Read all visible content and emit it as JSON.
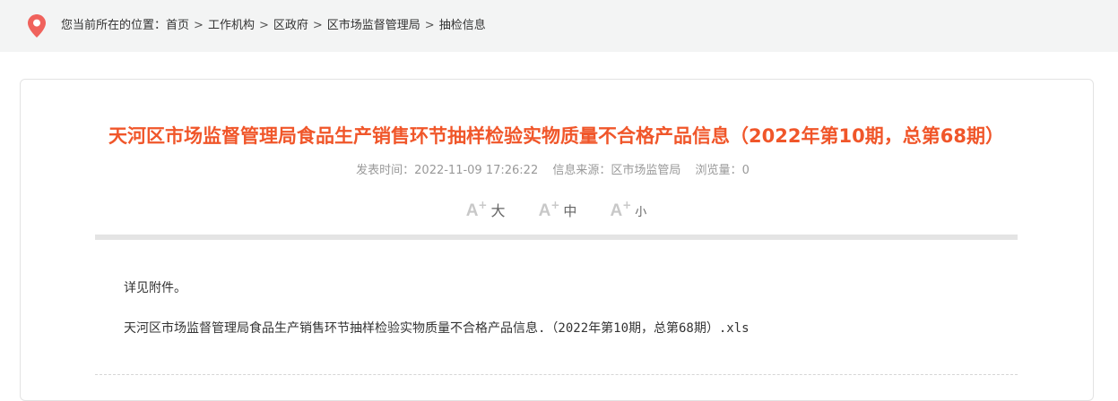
{
  "breadcrumb": {
    "prefix": "您当前所在的位置：",
    "items": [
      "首页",
      "工作机构",
      "区政府",
      "区市场监督管理局",
      "抽检信息"
    ],
    "separator": ">"
  },
  "article": {
    "title": "天河区市场监督管理局食品生产销售环节抽样检验实物质量不合格产品信息（2022年第10期，总第68期）",
    "publish_label": "发表时间：",
    "publish_time": "2022-11-09 17:26:22",
    "source_label": "信息来源：",
    "source": "区市场监管局",
    "views_label": "浏览量：",
    "views": "0"
  },
  "font_size": {
    "glyph": "A",
    "plus": "+",
    "large": "大",
    "medium": "中",
    "small": "小"
  },
  "body": {
    "paragraph": "详见附件。",
    "attachment": "天河区市场监督管理局食品生产销售环节抽样检验实物质量不合格产品信息.（2022年第10期，总第68期）.xls"
  },
  "colors": {
    "title": "#f0562a",
    "location_pin": "#f0625c"
  }
}
